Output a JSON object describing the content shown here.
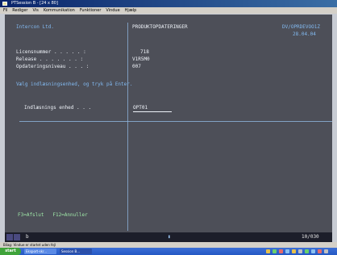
{
  "window": {
    "title": "PTSession B - [24 x 80]"
  },
  "menu": [
    "Fil",
    "Rediger",
    "Vis",
    "Kommunikation",
    "Funktioner",
    "Vindue",
    "Hjælp"
  ],
  "screen": {
    "company": "Intercon Ltd.",
    "screen_title": "PRODUKTOPDATERINGER",
    "program_id": "DV/OPRDEVOO1Z",
    "date": "28.04.04",
    "license_label": "Licensnummer . . . . . :",
    "license_value": "718",
    "release_label": "Release . . . . . . . :",
    "release_value": "V1R5M0",
    "level_label": "Opdateringsniveau . . . :",
    "level_value": "007",
    "instruction": "Vælg indlæsningsenhed, og tryk på Enter.",
    "unit_label": "Indlæsnings enhed . . .",
    "unit_value": "OPT01",
    "fkeys": "F3=Afslut   F12=Annuller"
  },
  "status": {
    "left": "b",
    "right": "10/030"
  },
  "info": "Bilag: Vindue er startet uden fejl",
  "taskbar": {
    "start": "start",
    "tasks": [
      "Eksport-skr...",
      "Session B..."
    ]
  }
}
